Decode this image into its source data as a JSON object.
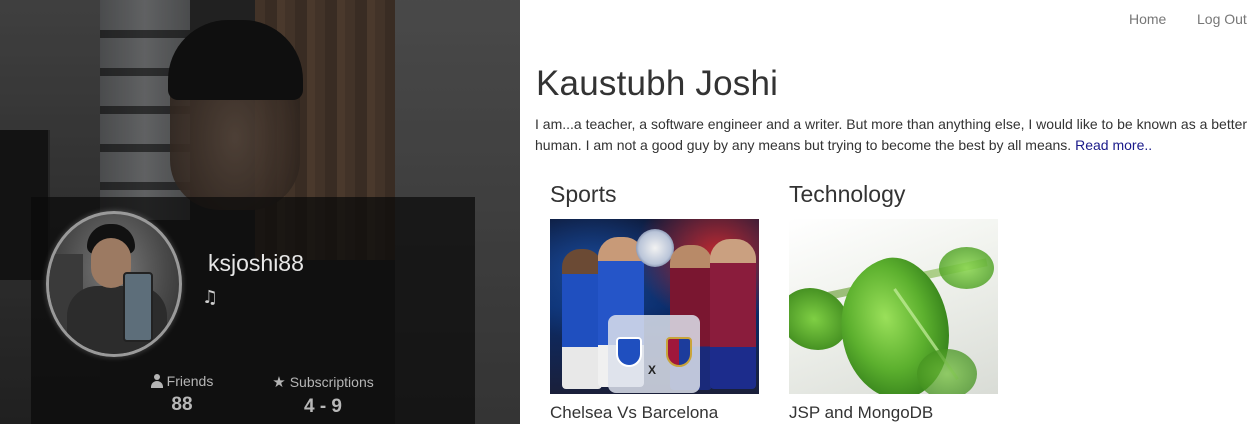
{
  "nav": {
    "home_label": "Home",
    "logout_label": "Log Out"
  },
  "profile": {
    "username": "ksjoshi88",
    "music_icon": "music-note-icon",
    "stats": {
      "friends_label": "Friends",
      "friends_count": "88",
      "subscriptions_label": "Subscriptions",
      "subscriptions_count": "4 - 9"
    }
  },
  "main": {
    "name": "Kaustubh Joshi",
    "bio_text": "I am...a teacher, a software engineer and a writer. But more than anything else, I would like to be known as a better human. I am not a good guy by any means but trying to become the best by all means. ",
    "read_more_label": "Read more.."
  },
  "categories": [
    {
      "title": "Sports",
      "post_title": "Chelsea Vs Barcelona",
      "thumb_icon": "sports-image"
    },
    {
      "title": "Technology",
      "post_title": "JSP and MongoDB",
      "thumb_icon": "leaf-image"
    }
  ],
  "colors": {
    "link": "#1a1a8a",
    "nav_text": "#777777",
    "heading": "#333333"
  }
}
